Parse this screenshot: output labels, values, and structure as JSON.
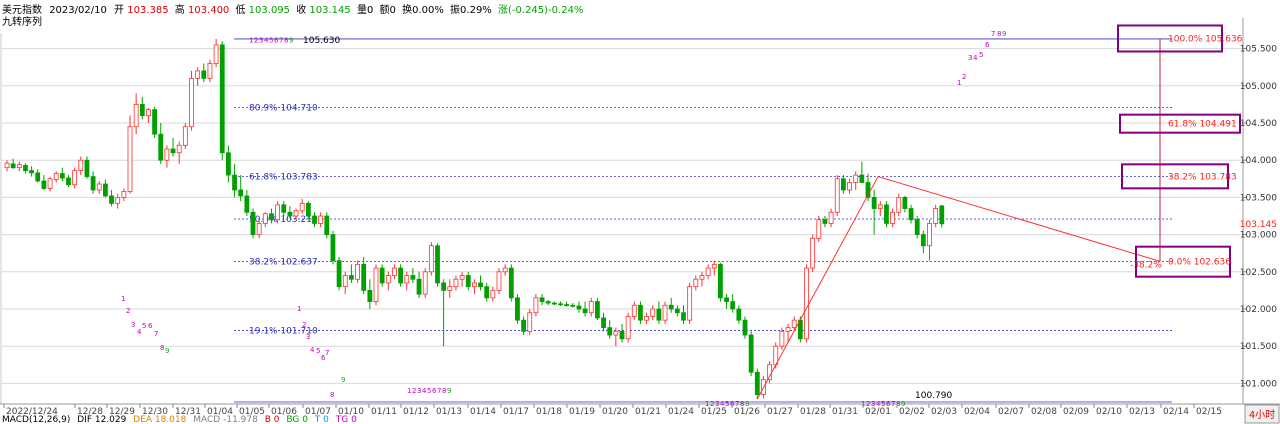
{
  "header": {
    "name": "美元指数",
    "date": "2023/02/10",
    "open_label": "开",
    "open": "103.385",
    "high_label": "高",
    "high": "103.400",
    "low_label": "低",
    "low": "103.095",
    "close_label": "收",
    "close": "103.145",
    "vol_label": "量0",
    "amt_label": "额0",
    "turn_label": "换0.00%",
    "amp_label": "振0.29%",
    "chg_label": "涨(-0.245)-0.24%",
    "indicator_name": "九转序列"
  },
  "footer": {
    "macd": "MACD(12,26,9)",
    "dif": "DIF 12.029",
    "dea": "DEA 18.018",
    "macd_val": "MACD -11.978",
    "b": "B 0",
    "bg": "BG 0",
    "t": "T 0",
    "tg": "TG 0",
    "period": "4小时"
  },
  "colors": {
    "up": "#ff3030",
    "down": "#00a000",
    "fib_line": "#3030c0",
    "fib_text": "#3030c0",
    "right_text": "#ff2020",
    "box": "#800080",
    "seq": "#c000c0",
    "seq_green": "#20a020"
  },
  "chart_data": {
    "type": "candlestick",
    "ylim": [
      100.75,
      105.75
    ],
    "y_ticks": [
      "105.500",
      "105.000",
      "104.500",
      "104.000",
      "103.500",
      "103.000",
      "102.500",
      "102.000",
      "101.500",
      "101.000"
    ],
    "last_price": "103.145",
    "x_labels": [
      "2022/12/24",
      "12/28",
      "12/29",
      "12/30",
      "12/31",
      "01/04",
      "01/05",
      "01/06",
      "01/07",
      "01/10",
      "01/11",
      "01/12",
      "01/13",
      "01/14",
      "01/17",
      "01/18",
      "01/19",
      "01/20",
      "01/21",
      "01/24",
      "01/25",
      "01/26",
      "01/27",
      "01/28",
      "01/31",
      "02/01",
      "02/02",
      "02/03",
      "02/04",
      "02/07",
      "02/08",
      "02/09",
      "02/10",
      "02/13",
      "02/14",
      "02/15"
    ],
    "peak_label": "105.630",
    "trough_label": "100.790",
    "left_fib": [
      {
        "label": "80.9% 104.710",
        "value": 104.71
      },
      {
        "label": "61.8% 103.783",
        "value": 103.783
      },
      {
        "label": "50.0% 103.210",
        "value": 103.21
      },
      {
        "label": "38.2% 102.637",
        "value": 102.637
      },
      {
        "label": "19.1% 101.710",
        "value": 101.71
      }
    ],
    "right_fib": [
      {
        "label": "100.0% 105.636",
        "value": 105.636
      },
      {
        "label": "61.8% 104.491",
        "value": 104.491
      },
      {
        "label": "38.2% 103.783",
        "value": 103.783
      },
      {
        "label": "0.0% 102.636",
        "value": 102.636
      }
    ],
    "right_fib_extra": "-38.2%",
    "seq_labels": [
      "1",
      "2",
      "3",
      "4",
      "5",
      "6",
      "7",
      "8",
      "9"
    ],
    "candles": [
      [
        103.9,
        104.0,
        103.85,
        103.96
      ],
      [
        103.95,
        104.02,
        103.88,
        103.9
      ],
      [
        103.9,
        103.98,
        103.85,
        103.94
      ],
      [
        103.93,
        103.96,
        103.82,
        103.86
      ],
      [
        103.86,
        103.92,
        103.78,
        103.83
      ],
      [
        103.83,
        103.88,
        103.7,
        103.72
      ],
      [
        103.72,
        103.8,
        103.6,
        103.62
      ],
      [
        103.62,
        103.78,
        103.58,
        103.75
      ],
      [
        103.74,
        103.85,
        103.7,
        103.82
      ],
      [
        103.82,
        103.9,
        103.72,
        103.76
      ],
      [
        103.76,
        103.8,
        103.64,
        103.67
      ],
      [
        103.67,
        103.9,
        103.62,
        103.86
      ],
      [
        103.86,
        104.05,
        103.8,
        104.0
      ],
      [
        104.0,
        104.05,
        103.75,
        103.78
      ],
      [
        103.78,
        103.85,
        103.55,
        103.6
      ],
      [
        103.6,
        103.72,
        103.55,
        103.68
      ],
      [
        103.68,
        103.74,
        103.5,
        103.52
      ],
      [
        103.52,
        103.6,
        103.38,
        103.42
      ],
      [
        103.42,
        103.55,
        103.35,
        103.5
      ],
      [
        103.5,
        103.62,
        103.45,
        103.58
      ],
      [
        103.58,
        104.6,
        103.55,
        104.45
      ],
      [
        104.45,
        104.9,
        104.35,
        104.75
      ],
      [
        104.75,
        104.85,
        104.55,
        104.6
      ],
      [
        104.6,
        104.7,
        104.5,
        104.68
      ],
      [
        104.68,
        104.72,
        104.3,
        104.35
      ],
      [
        104.35,
        104.5,
        103.95,
        104.0
      ],
      [
        104.0,
        104.2,
        103.9,
        104.15
      ],
      [
        104.15,
        104.3,
        104.05,
        104.1
      ],
      [
        104.1,
        104.25,
        103.95,
        104.2
      ],
      [
        104.2,
        104.5,
        104.15,
        104.45
      ],
      [
        104.45,
        105.2,
        104.4,
        105.1
      ],
      [
        105.1,
        105.25,
        105.0,
        105.2
      ],
      [
        105.2,
        105.3,
        105.05,
        105.1
      ],
      [
        105.1,
        105.35,
        105.05,
        105.3
      ],
      [
        105.3,
        105.63,
        105.25,
        105.55
      ],
      [
        105.55,
        105.6,
        104.0,
        104.1
      ],
      [
        104.1,
        104.2,
        103.7,
        103.8
      ],
      [
        103.8,
        103.95,
        103.5,
        103.6
      ],
      [
        103.6,
        103.8,
        103.45,
        103.52
      ],
      [
        103.52,
        103.6,
        103.25,
        103.3
      ],
      [
        103.3,
        103.35,
        102.95,
        103.0
      ],
      [
        103.0,
        103.2,
        102.95,
        103.15
      ],
      [
        103.15,
        103.3,
        103.1,
        103.28
      ],
      [
        103.28,
        103.35,
        103.15,
        103.2
      ],
      [
        103.2,
        103.45,
        103.15,
        103.4
      ],
      [
        103.4,
        103.45,
        103.25,
        103.3
      ],
      [
        103.3,
        103.38,
        103.22,
        103.25
      ],
      [
        103.25,
        103.35,
        103.2,
        103.32
      ],
      [
        103.32,
        103.48,
        103.28,
        103.42
      ],
      [
        103.42,
        103.45,
        103.2,
        103.25
      ],
      [
        103.25,
        103.3,
        103.1,
        103.15
      ],
      [
        103.15,
        103.3,
        103.1,
        103.25
      ],
      [
        103.25,
        103.3,
        102.95,
        103.0
      ],
      [
        103.0,
        103.05,
        102.6,
        102.65
      ],
      [
        102.65,
        102.7,
        102.25,
        102.3
      ],
      [
        102.3,
        102.5,
        102.2,
        102.45
      ],
      [
        102.45,
        102.6,
        102.35,
        102.4
      ],
      [
        102.4,
        102.65,
        102.35,
        102.6
      ],
      [
        102.6,
        102.7,
        102.2,
        102.25
      ],
      [
        102.25,
        102.4,
        102.0,
        102.1
      ],
      [
        102.1,
        102.6,
        102.05,
        102.55
      ],
      [
        102.55,
        102.6,
        102.3,
        102.35
      ],
      [
        102.35,
        102.5,
        102.25,
        102.45
      ],
      [
        102.45,
        102.6,
        102.4,
        102.55
      ],
      [
        102.55,
        102.6,
        102.3,
        102.35
      ],
      [
        102.35,
        102.5,
        102.25,
        102.45
      ],
      [
        102.45,
        102.55,
        102.35,
        102.4
      ],
      [
        102.4,
        102.5,
        102.15,
        102.2
      ],
      [
        102.2,
        102.55,
        102.15,
        102.5
      ],
      [
        102.5,
        102.9,
        102.45,
        102.85
      ],
      [
        102.85,
        102.88,
        102.3,
        102.35
      ],
      [
        102.35,
        102.4,
        101.5,
        102.25
      ],
      [
        102.25,
        102.4,
        102.15,
        102.3
      ],
      [
        102.3,
        102.45,
        102.25,
        102.4
      ],
      [
        102.4,
        102.5,
        102.3,
        102.45
      ],
      [
        102.45,
        102.5,
        102.25,
        102.3
      ],
      [
        102.3,
        102.4,
        102.2,
        102.35
      ],
      [
        102.35,
        102.45,
        102.25,
        102.3
      ],
      [
        102.3,
        102.35,
        102.1,
        102.15
      ],
      [
        102.15,
        102.3,
        102.1,
        102.25
      ],
      [
        102.25,
        102.55,
        102.2,
        102.5
      ],
      [
        102.5,
        102.6,
        102.45,
        102.55
      ],
      [
        102.55,
        102.6,
        102.1,
        102.15
      ],
      [
        102.15,
        102.2,
        101.8,
        101.85
      ],
      [
        101.85,
        101.9,
        101.65,
        101.7
      ],
      [
        101.7,
        102.0,
        101.65,
        101.95
      ],
      [
        101.95,
        102.2,
        101.9,
        102.15
      ],
      [
        102.15,
        102.2,
        102.05,
        102.1
      ],
      [
        102.1,
        102.12,
        102.05,
        102.08
      ],
      [
        102.08,
        102.1,
        102.05,
        102.07
      ],
      [
        102.07,
        102.1,
        102.04,
        102.06
      ],
      [
        102.06,
        102.1,
        102.03,
        102.05
      ],
      [
        102.05,
        102.08,
        102.02,
        102.04
      ],
      [
        102.04,
        102.1,
        101.95,
        102.0
      ],
      [
        102.0,
        102.1,
        101.9,
        101.95
      ],
      [
        101.95,
        102.15,
        101.9,
        102.1
      ],
      [
        102.1,
        102.15,
        101.85,
        101.88
      ],
      [
        101.88,
        101.95,
        101.7,
        101.75
      ],
      [
        101.75,
        101.85,
        101.6,
        101.65
      ],
      [
        101.65,
        101.75,
        101.5,
        101.7
      ],
      [
        101.7,
        101.8,
        101.55,
        101.6
      ],
      [
        101.6,
        101.95,
        101.55,
        101.9
      ],
      [
        101.9,
        102.1,
        101.85,
        102.05
      ],
      [
        102.05,
        102.1,
        101.8,
        101.85
      ],
      [
        101.85,
        101.95,
        101.8,
        101.9
      ],
      [
        101.9,
        102.05,
        101.85,
        102.0
      ],
      [
        102.0,
        102.1,
        101.8,
        101.85
      ],
      [
        101.85,
        102.1,
        101.8,
        102.05
      ],
      [
        102.05,
        102.15,
        101.95,
        102.0
      ],
      [
        102.0,
        102.05,
        101.9,
        101.95
      ],
      [
        101.95,
        102.05,
        101.8,
        101.85
      ],
      [
        101.85,
        102.35,
        101.8,
        102.3
      ],
      [
        102.3,
        102.45,
        102.25,
        102.4
      ],
      [
        102.4,
        102.5,
        102.3,
        102.45
      ],
      [
        102.45,
        102.6,
        102.4,
        102.55
      ],
      [
        102.55,
        102.65,
        102.45,
        102.6
      ],
      [
        102.6,
        102.62,
        102.1,
        102.15
      ],
      [
        102.15,
        102.2,
        102.0,
        102.1
      ],
      [
        102.1,
        102.2,
        101.95,
        102.0
      ],
      [
        102.0,
        102.05,
        101.8,
        101.85
      ],
      [
        101.85,
        101.9,
        101.6,
        101.65
      ],
      [
        101.65,
        101.7,
        101.1,
        101.15
      ],
      [
        101.15,
        101.2,
        100.79,
        100.85
      ],
      [
        100.85,
        101.1,
        100.8,
        101.05
      ],
      [
        101.05,
        101.3,
        101.0,
        101.25
      ],
      [
        101.25,
        101.55,
        101.2,
        101.5
      ],
      [
        101.5,
        101.75,
        101.45,
        101.7
      ],
      [
        101.7,
        101.8,
        101.55,
        101.75
      ],
      [
        101.75,
        101.9,
        101.7,
        101.85
      ],
      [
        101.85,
        101.9,
        101.55,
        101.6
      ],
      [
        101.6,
        102.6,
        101.55,
        102.55
      ],
      [
        102.55,
        103.0,
        102.5,
        102.95
      ],
      [
        102.95,
        103.25,
        102.9,
        103.2
      ],
      [
        103.2,
        103.25,
        103.1,
        103.15
      ],
      [
        103.15,
        103.35,
        103.1,
        103.3
      ],
      [
        103.3,
        103.8,
        103.25,
        103.75
      ],
      [
        103.75,
        103.8,
        103.55,
        103.6
      ],
      [
        103.6,
        103.75,
        103.55,
        103.7
      ],
      [
        103.7,
        103.85,
        103.6,
        103.8
      ],
      [
        103.8,
        103.98,
        103.75,
        103.7
      ],
      [
        103.7,
        103.82,
        103.45,
        103.5
      ],
      [
        103.5,
        103.6,
        103.0,
        103.35
      ],
      [
        103.35,
        103.45,
        103.25,
        103.4
      ],
      [
        103.4,
        103.45,
        103.1,
        103.15
      ],
      [
        103.15,
        103.35,
        103.1,
        103.3
      ],
      [
        103.3,
        103.55,
        103.25,
        103.5
      ],
      [
        103.5,
        103.52,
        103.3,
        103.35
      ],
      [
        103.35,
        103.4,
        103.15,
        103.2
      ],
      [
        103.2,
        103.25,
        102.95,
        103.0
      ],
      [
        103.0,
        103.05,
        102.75,
        102.85
      ],
      [
        102.85,
        103.2,
        102.65,
        103.15
      ],
      [
        103.15,
        103.4,
        103.1,
        103.35
      ],
      [
        103.385,
        103.4,
        103.095,
        103.145
      ]
    ]
  }
}
